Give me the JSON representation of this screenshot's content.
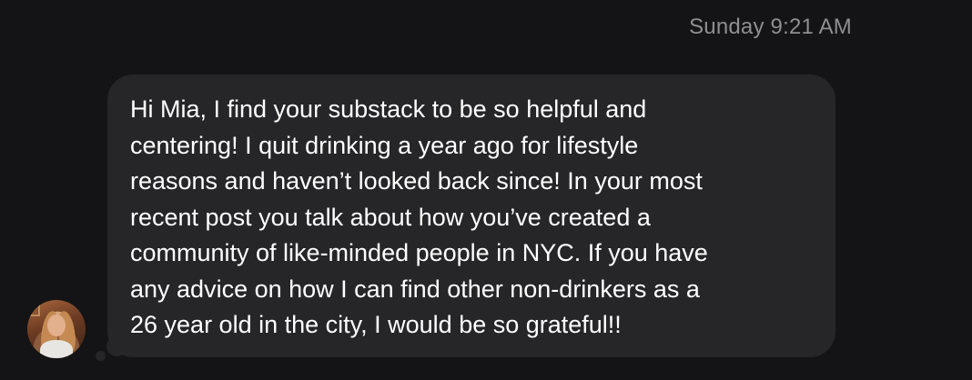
{
  "thread": {
    "timestamp": "Sunday 9:21 AM"
  },
  "message": {
    "text": "Hi Mia, I find your substack to be so helpful and\ncentering! I quit drinking a year ago for lifestyle\nreasons and haven’t looked back since! In your most\nrecent post you talk about how you’ve created a\ncommunity of like-minded people in NYC. If you have\nany advice on how I can find other non-drinkers as a\n26 year old in the city, I would be so grateful!!",
    "bubble_color": "#262628"
  },
  "theme": {
    "background": "#141416",
    "timestamp_color": "#8e8e93",
    "text_color": "#ffffff"
  }
}
